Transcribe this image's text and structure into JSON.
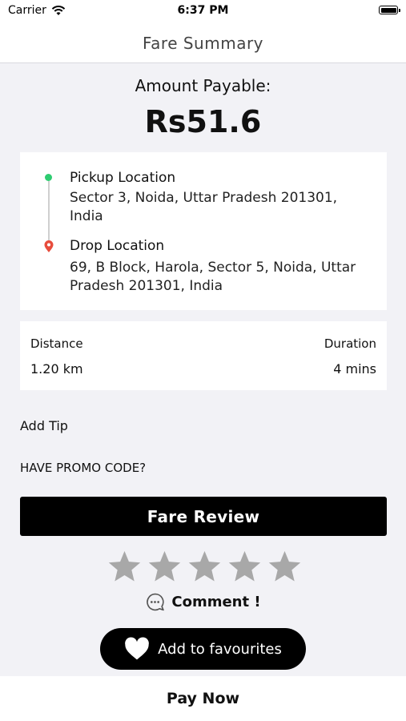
{
  "status_bar": {
    "carrier": "Carrier",
    "time": "6:37 PM",
    "icons": [
      "wifi-icon",
      "battery-icon"
    ]
  },
  "nav": {
    "title": "Fare Summary"
  },
  "fare": {
    "amount_label": "Amount Payable:",
    "amount_value": "Rs51.6"
  },
  "locations": {
    "pickup_label": "Pickup Location",
    "pickup_address": "Sector 3, Noida, Uttar Pradesh 201301, India",
    "drop_label": "Drop Location",
    "drop_address": "69, B Block, Harola, Sector 5, Noida, Uttar Pradesh 201301, India",
    "pickup_color": "#2ecc71",
    "drop_color": "#e74c3c"
  },
  "trip": {
    "distance_label": "Distance",
    "distance_value": "1.20 km",
    "duration_label": "Duration",
    "duration_value": "4 mins"
  },
  "add_tip": "Add Tip",
  "promo": "HAVE PROMO CODE?",
  "fare_review": "Fare Review",
  "rating": {
    "max": 5,
    "value": 0,
    "star_color": "#a8a8a8"
  },
  "comment": "Comment !",
  "favourite": "Add to favourites",
  "pay_now": "Pay Now"
}
